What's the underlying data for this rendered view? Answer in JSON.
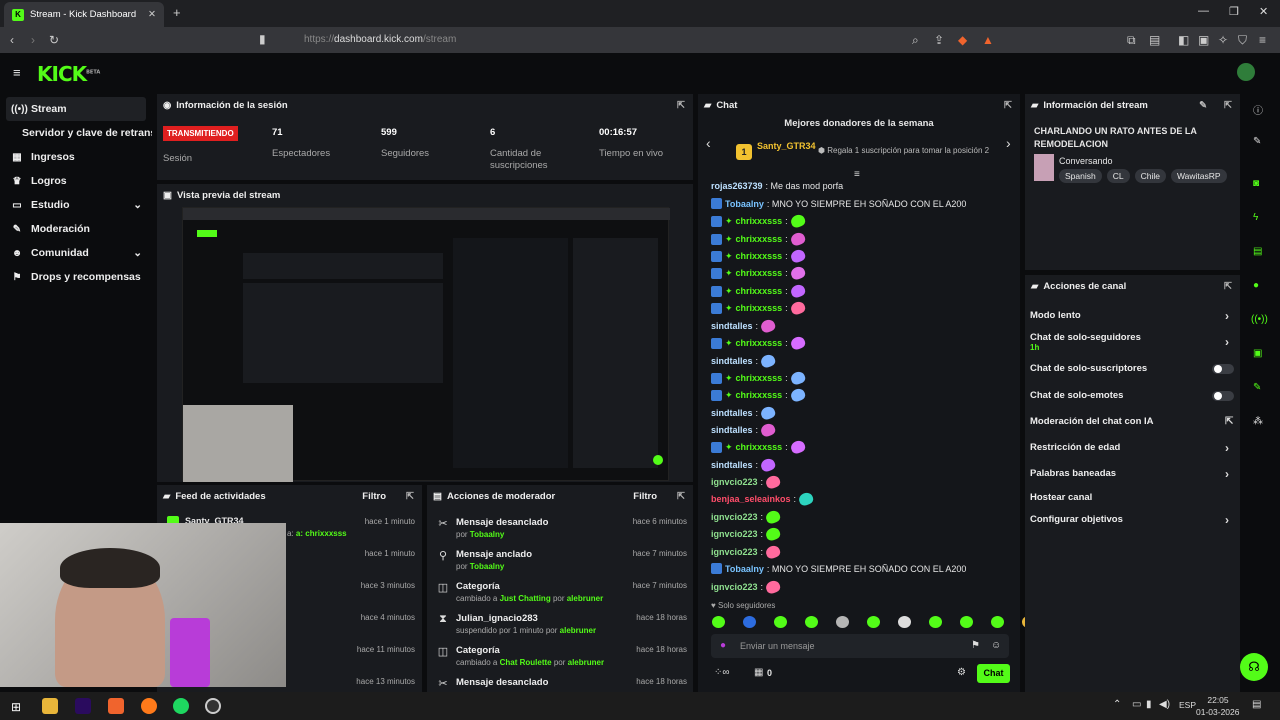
{
  "browser": {
    "tab_title": "Stream - Kick Dashboard",
    "url": "https://dashboard.kick.com/stream",
    "url_host": "dashboard.kick.com",
    "url_path": "/stream",
    "url_scheme": "https://"
  },
  "app": {
    "logo": "KICK",
    "logo_beta": "BETA"
  },
  "sidebar": {
    "items": [
      {
        "label": "Stream",
        "icon": "broadcast-icon"
      },
      {
        "label": "Servidor y clave de retransmisión"
      },
      {
        "label": "Ingresos",
        "icon": "chart-icon"
      },
      {
        "label": "Logros",
        "icon": "trophy-icon"
      },
      {
        "label": "Estudio",
        "icon": "studio-icon"
      },
      {
        "label": "Moderación",
        "icon": "wrench-icon"
      },
      {
        "label": "Comunidad",
        "icon": "people-icon"
      },
      {
        "label": "Drops y recompensas",
        "icon": "gift-icon"
      }
    ]
  },
  "session": {
    "title": "Información de la sesión",
    "status": "TRANSMITIENDO",
    "status_label": "Sesión",
    "viewers": "71",
    "viewers_label": "Espectadores",
    "followers": "599",
    "followers_label": "Seguidores",
    "subs": "6",
    "subs_label": "Cantidad de suscripciones",
    "time": "00:16:57",
    "time_label": "Tiempo en vivo"
  },
  "preview": {
    "title": "Vista previa del stream"
  },
  "feed": {
    "title": "Feed de actividades",
    "filter": "Filtro",
    "items": [
      {
        "user": "Santy_GTR34",
        "detail": "a: chrixxxsss",
        "time": "hace 1 minuto"
      },
      {
        "time": "hace 1 minuto"
      },
      {
        "time": "hace 3 minutos"
      },
      {
        "time": "hace 4 minutos"
      },
      {
        "time": "hace 11 minutos"
      },
      {
        "time": "hace 13 minutos"
      }
    ]
  },
  "mod": {
    "title": "Acciones de moderador",
    "filter": "Filtro",
    "items": [
      {
        "title": "Mensaje desanclado",
        "pre": "por",
        "who": "Tobaalny",
        "time": "hace 6 minutos"
      },
      {
        "title": "Mensaje anclado",
        "pre": "por",
        "who": "Tobaalny",
        "time": "hace 7 minutos"
      },
      {
        "title": "Categoría",
        "pre": "cambiado a",
        "who": "Just Chatting",
        "mid": "por",
        "by": "alebruner",
        "time": "hace 7 minutos"
      },
      {
        "title": "Julian_ignacio283",
        "pre": "suspendido por 1 minuto por",
        "who": "alebruner",
        "time": "hace 18 horas"
      },
      {
        "title": "Categoría",
        "pre": "cambiado a",
        "who": "Chat Roulette",
        "mid": "por",
        "by": "alebruner",
        "time": "hace 18 horas"
      },
      {
        "title": "Mensaje desanclado",
        "time": "hace 18 horas"
      }
    ]
  },
  "chat": {
    "title": "Chat",
    "donors_title": "Mejores donadores de la semana",
    "top_donor": "Santy_GTR34",
    "rank": "1",
    "gift_prompt": "Regala 1 suscripción para tomar la posición 2",
    "messages": [
      {
        "user": "rojas263739",
        "text": ": Me das mod porfa"
      },
      {
        "user": "Tobaalny",
        "text": ": MNO YO SIEMPRE EH SOÑADO CON EL A200"
      },
      {
        "user": "chrixxxsss",
        "text": ":"
      },
      {
        "user": "chrixxxsss",
        "text": ":"
      },
      {
        "user": "chrixxxsss",
        "text": ":"
      },
      {
        "user": "chrixxxsss",
        "text": ":"
      },
      {
        "user": "chrixxxsss",
        "text": ":"
      },
      {
        "user": "chrixxxsss",
        "text": ":"
      },
      {
        "user": "sindtalles",
        "text": ":"
      },
      {
        "user": "chrixxxsss",
        "text": ":"
      },
      {
        "user": "sindtalles",
        "text": ":"
      },
      {
        "user": "chrixxxsss",
        "text": ":"
      },
      {
        "user": "chrixxxsss",
        "text": ":"
      },
      {
        "user": "sindtalles",
        "text": ":"
      },
      {
        "user": "sindtalles",
        "text": ":"
      },
      {
        "user": "chrixxxsss",
        "text": ":"
      },
      {
        "user": "sindtalles",
        "text": ":"
      },
      {
        "user": "ignvcio223",
        "text": ":"
      },
      {
        "user": "benjaa_seleainkos",
        "text": ":"
      },
      {
        "user": "ignvcio223",
        "text": ":"
      },
      {
        "user": "ignvcio223",
        "text": ":"
      },
      {
        "user": "ignvcio223",
        "text": ":"
      },
      {
        "user": "Tobaalny",
        "text": ": MNO YO SIEMPRE EH SOÑADO CON EL A200"
      },
      {
        "user": "ignvcio223",
        "text": ":"
      }
    ],
    "mode": "Solo seguidores",
    "placeholder": "Enviar un mensaje",
    "points": "0",
    "send": "Chat"
  },
  "stream_info": {
    "title": "Información del stream",
    "stream_title": "CHARLANDO UN RATO ANTES DE LA REMODELACION",
    "category": "Conversando",
    "tags": [
      "Spanish",
      "CL",
      "Chile",
      "WawitasRP"
    ]
  },
  "actions": {
    "title": "Acciones de canal",
    "items": [
      {
        "label": "Modo lento"
      },
      {
        "label": "Chat de solo-seguidores",
        "sub": "1h"
      },
      {
        "label": "Chat de solo-suscriptores"
      },
      {
        "label": "Chat de solo-emotes"
      },
      {
        "label": "Moderación del chat con IA"
      },
      {
        "label": "Restricción de edad"
      },
      {
        "label": "Palabras baneadas"
      },
      {
        "label": "Hostear canal"
      },
      {
        "label": "Configurar objetivos"
      }
    ]
  },
  "taskbar": {
    "lang": "ESP",
    "time": "22:05",
    "date": "01-03-2026"
  },
  "colors": {
    "accent": "#53fc18",
    "live": "#e01f1f",
    "panel": "#191b1f",
    "bg": "#0b0c0e"
  }
}
